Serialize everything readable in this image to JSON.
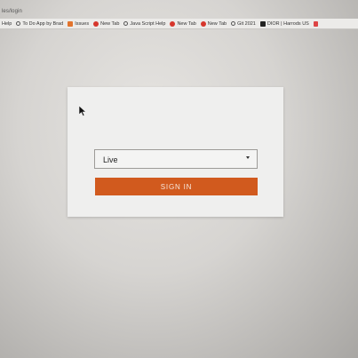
{
  "browser": {
    "url_fragment": "les/login",
    "bookmarks": [
      {
        "label": "Help",
        "icon": "none"
      },
      {
        "label": "To Do App by Brad",
        "icon": "globe-icon"
      },
      {
        "label": "Issues",
        "icon": "issues-icon"
      },
      {
        "label": "New Tab",
        "icon": "new-tab-icon"
      },
      {
        "label": "Java Script Help",
        "icon": "globe-icon"
      },
      {
        "label": "New Tab",
        "icon": "new-tab-icon"
      },
      {
        "label": "New Tab",
        "icon": "new-tab-icon"
      },
      {
        "label": "Git 2021",
        "icon": "globe-icon"
      },
      {
        "label": "DIOR | Harrods US",
        "icon": "dior-icon"
      },
      {
        "label": "",
        "icon": "gmail-icon"
      }
    ]
  },
  "login": {
    "environment_select": {
      "value": "Live"
    },
    "signin_label": "SIGN IN"
  },
  "colors": {
    "accent": "#d15a1e",
    "card_bg": "#efefee"
  }
}
